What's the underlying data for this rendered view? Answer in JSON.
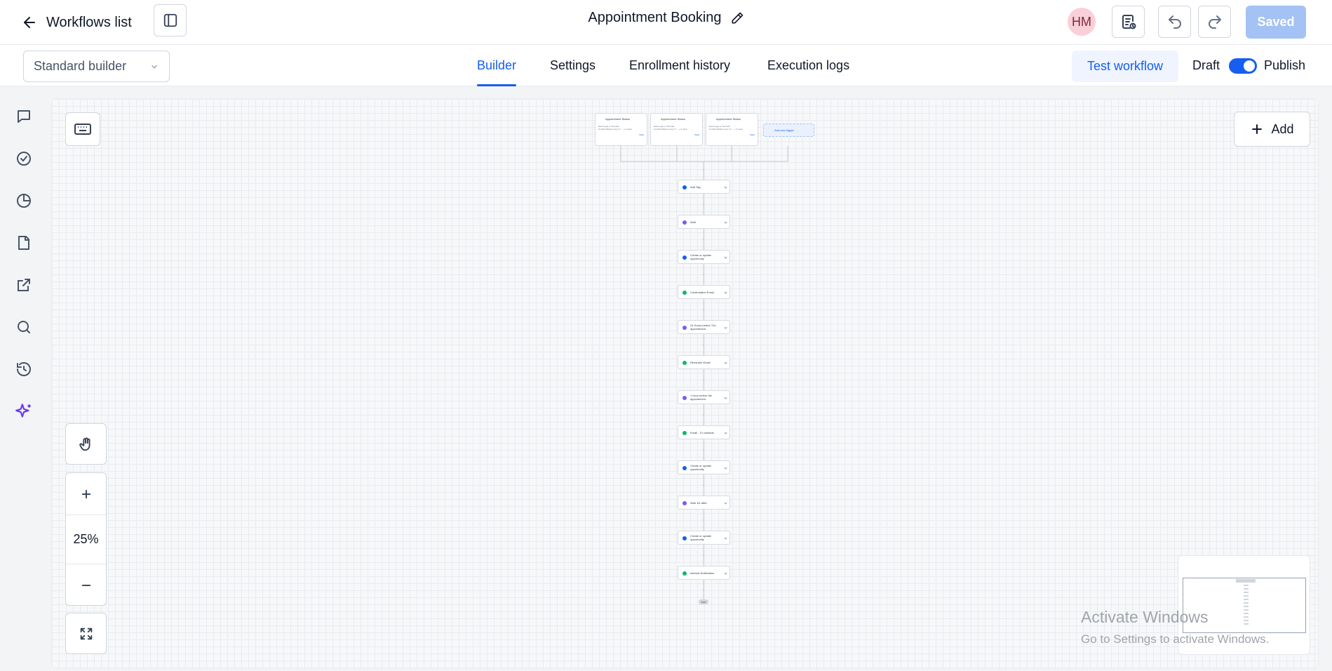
{
  "header": {
    "back_label": "Workflows list",
    "workflow_title": "Appointment Booking",
    "avatar_initials": "HM",
    "saved_label": "Saved",
    "avatar_color": "#fbcfd8",
    "accent_color": "#155eef"
  },
  "subbar": {
    "builder_mode": "Standard builder",
    "tabs": [
      {
        "label": "Builder",
        "active": true
      },
      {
        "label": "Settings",
        "active": false
      },
      {
        "label": "Enrollment history",
        "active": false
      },
      {
        "label": "Execution logs",
        "active": false
      }
    ],
    "test_label": "Test workflow",
    "draft_label": "Draft",
    "publish_label": "Publish"
  },
  "rail_icons": [
    "chat-icon",
    "check-circle-icon",
    "pie-chart-icon",
    "file-icon",
    "external-link-icon",
    "search-icon",
    "history-icon",
    "sparkles-icon"
  ],
  "canvas": {
    "zoom_level": "25%",
    "add_label": "Add",
    "triggers": [
      {
        "title": "Appointment Status",
        "line1": "Event type is \"Normal\"",
        "line2": "Contact Mode is any of \"...",
        "extra": "+ 2 more",
        "stats": "Stats"
      },
      {
        "title": "Appointment Status",
        "line1": "Event type is \"Normal\"",
        "line2": "Contact Mode is any of \"...",
        "extra": "+ 2 more",
        "stats": "Stats"
      },
      {
        "title": "Appointment Status",
        "line1": "Event type is \"Normal\"",
        "line2": "Contact Mode is any of \"...",
        "extra": "+ 2 more",
        "stats": "Stats"
      }
    ],
    "add_trigger_label": "Add new trigger",
    "actions": [
      {
        "label": "Add Tag",
        "color": "#155eef"
      },
      {
        "label": "Wait",
        "color": "#7a5af8"
      },
      {
        "label": "Create or update opportunity",
        "color": "#155eef"
      },
      {
        "label": "Confirmation Email",
        "color": "#12b76a"
      },
      {
        "label": "24 Hours before The appointment",
        "color": "#7a5af8"
      },
      {
        "label": "Reminder Email",
        "color": "#12b76a"
      },
      {
        "label": "1 Hour before the appointment",
        "color": "#7a5af8"
      },
      {
        "label": "Email - To contacts",
        "color": "#12b76a"
      },
      {
        "label": "Create or update opportunity",
        "color": "#155eef"
      },
      {
        "label": "Wait 1hr after",
        "color": "#7a5af8"
      },
      {
        "label": "Create or update opportunity",
        "color": "#155eef"
      },
      {
        "label": "Internal Notification",
        "color": "#12b76a"
      }
    ],
    "end_label": "END"
  },
  "watermark": {
    "line1": "Activate Windows",
    "line2": "Go to Settings to activate Windows."
  }
}
